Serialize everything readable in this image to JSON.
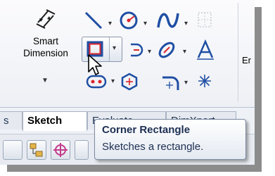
{
  "smart_dimension": {
    "line1": "Smart",
    "line2": "Dimension"
  },
  "ribbon_overflow_label": "Er",
  "tabs": [
    {
      "label": "s"
    },
    {
      "label": "Sketch"
    },
    {
      "label": "Evaluate"
    },
    {
      "label": "DimXpert"
    }
  ],
  "tooltip": {
    "title": "Corner Rectangle",
    "description": "Sketches a rectangle."
  },
  "colors": {
    "accent_red": "#d8262b",
    "tool_blue": "#1f4fa3",
    "tooltip_text": "#1c2f52"
  }
}
